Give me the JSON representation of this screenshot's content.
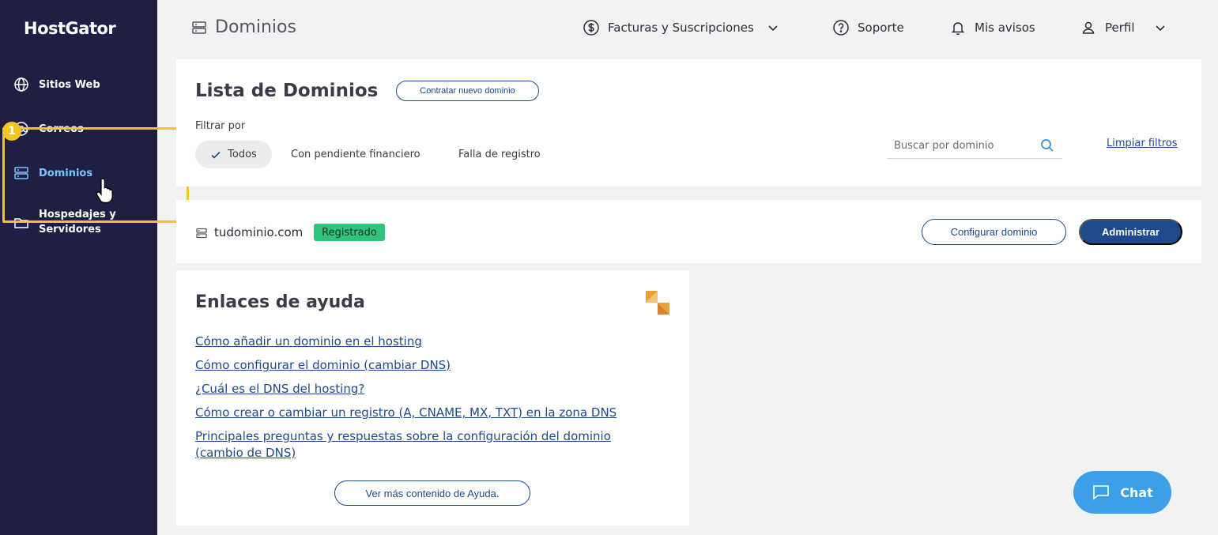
{
  "brand": {
    "logo_text": "HostGator"
  },
  "sidebar": {
    "items": [
      {
        "label": "Sitios Web",
        "icon": "globe-icon"
      },
      {
        "label": "Correos",
        "icon": "email-icon"
      },
      {
        "label": "Dominios",
        "icon": "server-icon",
        "active": true
      },
      {
        "label": "Hospedajes y Servidores",
        "icon": "folder-icon"
      }
    ],
    "highlight_step": "1"
  },
  "header": {
    "page_title": "Dominios",
    "nav": {
      "facturas": "Facturas y Suscripciones",
      "soporte": "Soporte",
      "avisos": "Mis avisos",
      "perfil": "Perfil"
    }
  },
  "domain_list": {
    "title": "Lista de Dominios",
    "new_domain_button": "Contratar nuevo dominio",
    "filter_label": "Filtrar por",
    "filters": [
      "Todos",
      "Con pendiente financiero",
      "Falla de registro"
    ],
    "selected_filter": "Todos",
    "search_placeholder": "Buscar por dominio",
    "clear_filters": "Limpiar filtros"
  },
  "domains": [
    {
      "name": "tudominio.com",
      "status": "Registrado",
      "configure_button": "Configurar dominio",
      "manage_button": "Administrar"
    }
  ],
  "help": {
    "title": "Enlaces de ayuda",
    "links": [
      "Cómo añadir un dominio en el hosting",
      "Cómo configurar el dominio (cambiar DNS)",
      "¿Cuál es el DNS del hosting?",
      "Cómo crear o cambiar un registro (A, CNAME, MX, TXT) en la zona DNS",
      "Principales preguntas y respuestas sobre la configuración del dominio (cambio de DNS)"
    ],
    "more_button": "Ver más contenido de Ayuda."
  },
  "chat": {
    "label": "Chat"
  },
  "colors": {
    "sidebar_bg": "#1f1f44",
    "accent_blue": "#1d4a8a",
    "active_nav": "#7cc4ff",
    "highlight": "#f2c61f",
    "status_green": "#31c27c",
    "chat_blue": "#3b9fea"
  }
}
